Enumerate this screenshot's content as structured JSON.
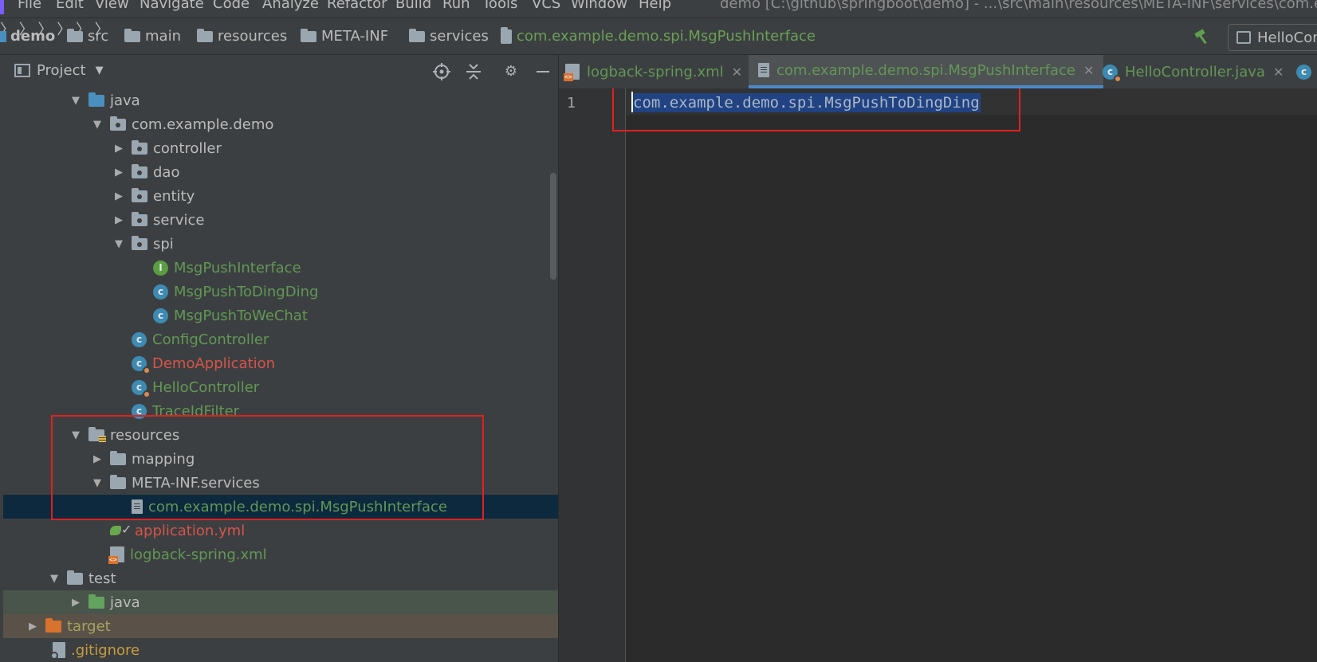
{
  "menubar": {
    "items": [
      "File",
      "Edit",
      "View",
      "Navigate",
      "Code",
      "Analyze",
      "Refactor",
      "Build",
      "Run",
      "Tools",
      "VCS",
      "Window",
      "Help"
    ],
    "window_title": "demo [C:\\github\\springboot\\demo] - ...\\src\\main\\resources\\META-INF\\services\\com.ex"
  },
  "navbar": {
    "crumbs": [
      "demo",
      "src",
      "main",
      "resources",
      "META-INF",
      "services",
      "com.example.demo.spi.MsgPushInterface"
    ],
    "run_config": "HelloCon"
  },
  "project_panel": {
    "title": "Project",
    "tree": [
      {
        "label": "java",
        "arrow": "▼",
        "icon": "folder-blue-icon",
        "color": "default"
      },
      {
        "label": "com.example.demo",
        "arrow": "▼",
        "icon": "package-icon",
        "color": "default"
      },
      {
        "label": "controller",
        "arrow": "▶",
        "icon": "package-icon",
        "color": "default"
      },
      {
        "label": "dao",
        "arrow": "▶",
        "icon": "package-icon",
        "color": "default"
      },
      {
        "label": "entity",
        "arrow": "▶",
        "icon": "package-icon",
        "color": "default"
      },
      {
        "label": "service",
        "arrow": "▶",
        "icon": "package-icon",
        "color": "default"
      },
      {
        "label": "spi",
        "arrow": "▼",
        "icon": "package-icon",
        "color": "default"
      },
      {
        "label": "MsgPushInterface",
        "arrow": "",
        "icon": "interface-icon",
        "color": "green"
      },
      {
        "label": "MsgPushToDingDing",
        "arrow": "",
        "icon": "class-icon",
        "color": "green"
      },
      {
        "label": "MsgPushToWeChat",
        "arrow": "",
        "icon": "class-icon",
        "color": "green"
      },
      {
        "label": "ConfigController",
        "arrow": "",
        "icon": "class-icon",
        "color": "green"
      },
      {
        "label": "DemoApplication",
        "arrow": "",
        "icon": "spring-class-icon",
        "color": "red"
      },
      {
        "label": "HelloController",
        "arrow": "",
        "icon": "spring-class-icon",
        "color": "green"
      },
      {
        "label": "TraceIdFilter",
        "arrow": "",
        "icon": "class-icon",
        "color": "green"
      },
      {
        "label": "resources",
        "arrow": "▼",
        "icon": "resources-folder-icon",
        "color": "default"
      },
      {
        "label": "mapping",
        "arrow": "▶",
        "icon": "folder-icon",
        "color": "default"
      },
      {
        "label": "META-INF.services",
        "arrow": "▼",
        "icon": "folder-icon",
        "color": "default"
      },
      {
        "label": "com.example.demo.spi.MsgPushInterface",
        "arrow": "",
        "icon": "text-file-icon",
        "color": "green"
      },
      {
        "label": "application.yml",
        "arrow": "",
        "icon": "yaml-file-icon",
        "color": "red"
      },
      {
        "label": "logback-spring.xml",
        "arrow": "",
        "icon": "xml-file-icon",
        "color": "green"
      },
      {
        "label": "test",
        "arrow": "▼",
        "icon": "folder-icon",
        "color": "default"
      },
      {
        "label": "java",
        "arrow": "▶",
        "icon": "folder-green-icon",
        "color": "default"
      },
      {
        "label": "target",
        "arrow": "▶",
        "icon": "folder-orange-icon",
        "color": "olive"
      },
      {
        "label": ".gitignore",
        "arrow": "",
        "icon": "git-file-icon",
        "color": "orange"
      }
    ]
  },
  "editor": {
    "tabs": [
      {
        "label": "logback-spring.xml",
        "icon": "xml-file-icon"
      },
      {
        "label": "com.example.demo.spi.MsgPushInterface",
        "icon": "text-file-icon"
      },
      {
        "label": "HelloController.java",
        "icon": "spring-class-icon"
      }
    ],
    "line_number": "1",
    "code_line": "com.example.demo.spi.MsgPushToDingDing"
  },
  "colors": {
    "accent": "#4a88c7",
    "highlight_box": "#e0211f",
    "selection": "#214283",
    "green_file": "#629755",
    "red_file": "#d8534a"
  }
}
